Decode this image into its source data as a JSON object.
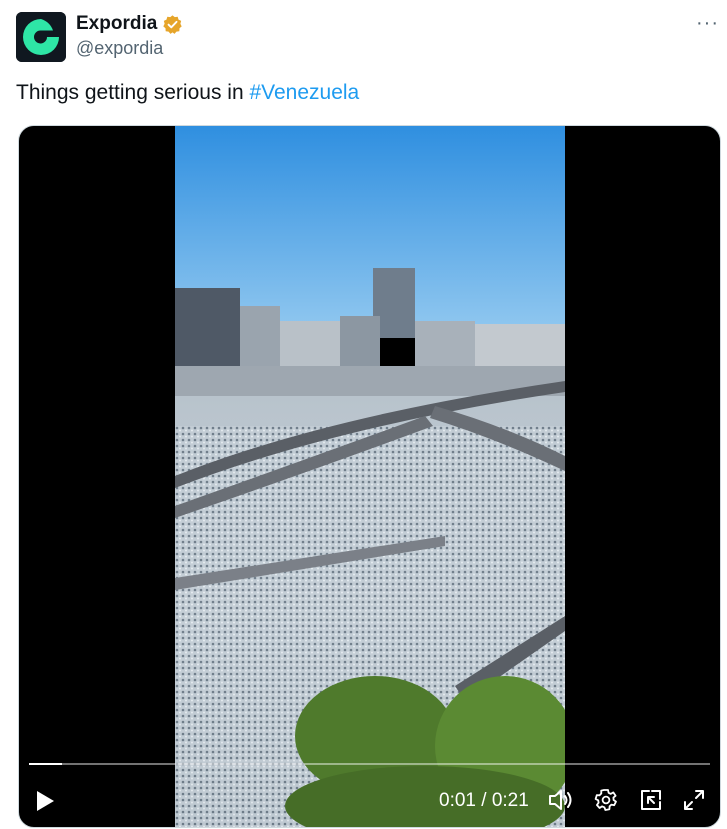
{
  "account": {
    "display_name": "Expordia",
    "handle": "@expordia",
    "avatar_icon": "expordia-logo",
    "verified_icon": "verified-badge-gold",
    "verified_color": "#e6a52a"
  },
  "more_label": "···",
  "tweet": {
    "text": "Things getting serious in ",
    "hashtag": "#Venezuela",
    "hashtag_color": "#1d9bf0"
  },
  "video": {
    "current_time": "0:01",
    "separator": " / ",
    "duration": "0:21",
    "progress_fraction": 0.048,
    "icons": {
      "play": "play-icon",
      "volume": "volume-icon",
      "settings": "gear-icon",
      "pip": "pip-icon",
      "fullscreen": "fullscreen-icon"
    }
  }
}
